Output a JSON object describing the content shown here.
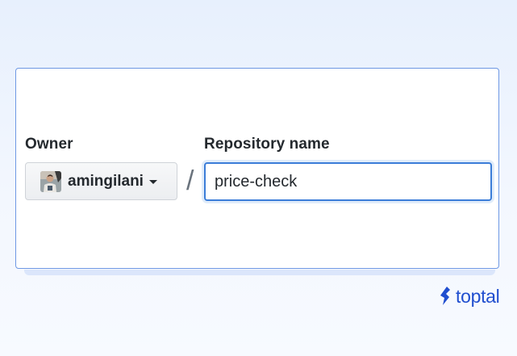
{
  "form": {
    "owner_label": "Owner",
    "repo_label": "Repository name",
    "separator": "/",
    "owner": {
      "username": "amingilani",
      "avatar_icon": "user-avatar",
      "dropdown_icon": "caret-down-icon"
    },
    "repo_input": {
      "value": "price-check",
      "placeholder": ""
    }
  },
  "branding": {
    "logo_text": "toptal",
    "logo_icon": "toptal-logo-icon",
    "color": "#204ecf"
  },
  "colors": {
    "card_border": "#6e98e4",
    "input_focus_border": "#3b7dd8",
    "text": "#24292e",
    "background_top": "#e7f0fd"
  }
}
